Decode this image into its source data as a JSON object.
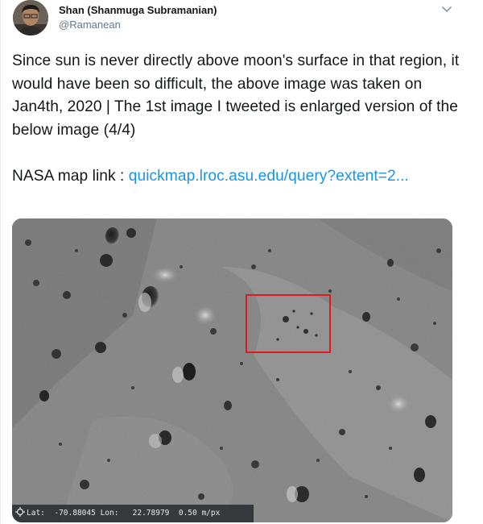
{
  "tweet": {
    "author_name": "Shan (Shanmuga Subramanian)",
    "author_handle": "@Ramanean",
    "menu_icon": "chevron-down-icon",
    "text_paragraph_1": "Since sun is never directly above moon's surface in that region, it would have been so difficult, the above image was taken on Jan4th, 2020  | The 1st image I tweeted is enlarged version of the below image (4/4)",
    "text_paragraph_2_prefix": "NASA map link : ",
    "link_text": "quickmap.lroc.asu.edu/query?extent=2...",
    "colors": {
      "link": "#1b95e0",
      "text": "#14171a",
      "handle": "#657786",
      "highlight_box": "#e0191e"
    }
  },
  "media": {
    "description_icon": "crosshair-icon",
    "coords": {
      "lat_label": "Lat:",
      "lat_value": "-70.88045",
      "lon_label": "Lon:",
      "lon_value": "22.78979",
      "scale_value": "0.50 m/px"
    }
  }
}
